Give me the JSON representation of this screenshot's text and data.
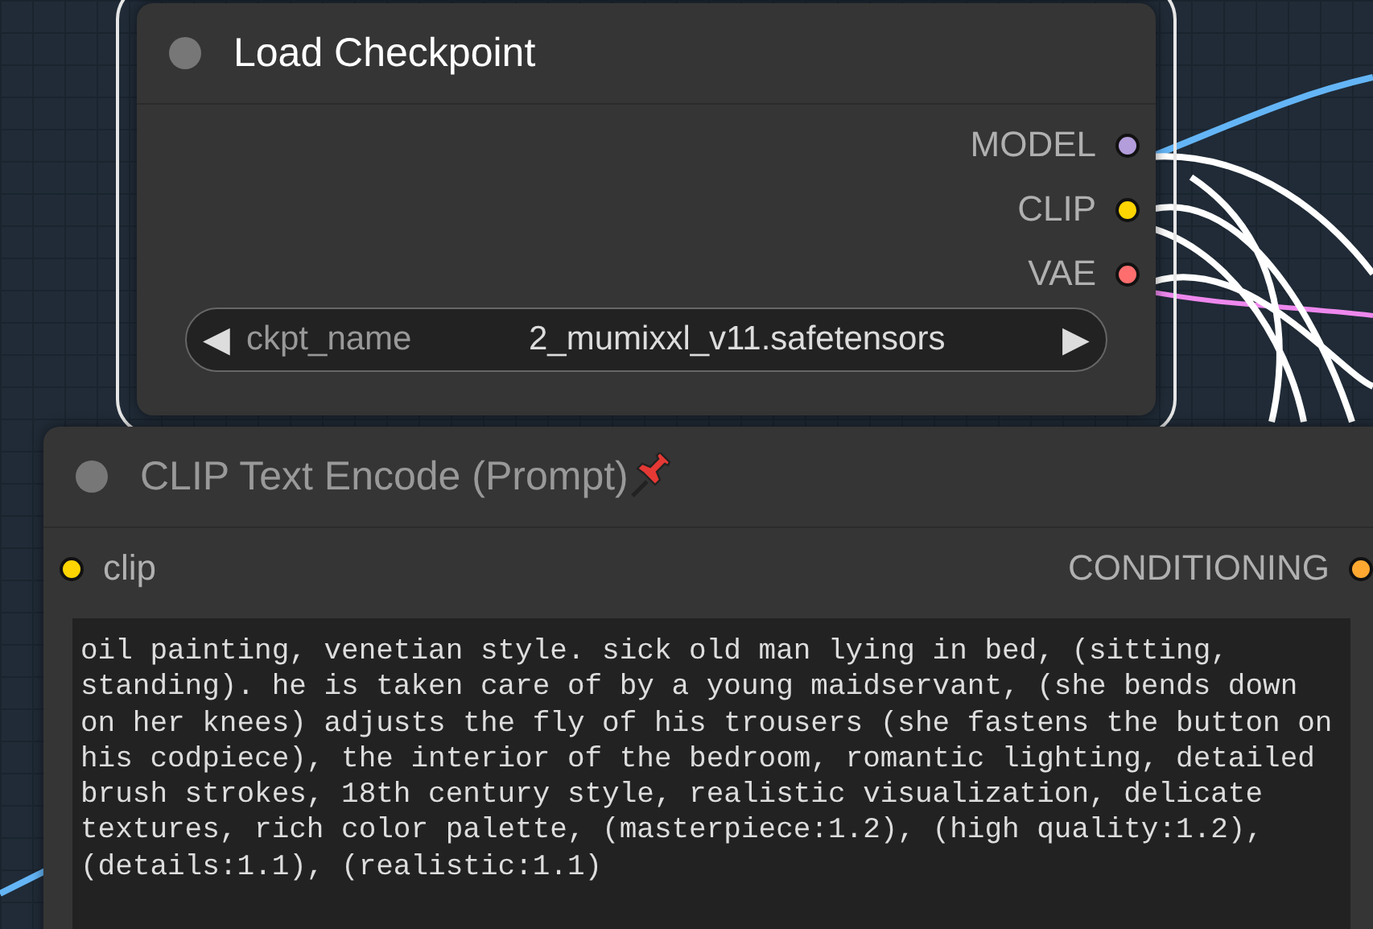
{
  "nodes": [
    {
      "title": "Load Checkpoint",
      "selected": true,
      "pinned": false,
      "outputs": [
        {
          "name": "MODEL",
          "color": "#b39ddb"
        },
        {
          "name": "CLIP",
          "color": "#ffd500"
        },
        {
          "name": "VAE",
          "color": "#ff6e6e"
        }
      ],
      "widgets": [
        {
          "kind": "combo",
          "name": "ckpt_name",
          "value": "2_mumixxl_v11.safetensors",
          "prev": "◀",
          "next": "▶"
        }
      ]
    },
    {
      "title": "CLIP Text Encode (Prompt)",
      "selected": false,
      "pinned": true,
      "inputs": [
        {
          "name": "clip",
          "color": "#ffd500"
        }
      ],
      "outputs": [
        {
          "name": "CONDITIONING",
          "color": "#ffa931"
        }
      ],
      "widgets": [
        {
          "kind": "text",
          "value": "oil painting, venetian style. sick old man lying in bed, (sitting, standing). he is taken care of by a young maidservant, (she bends down on her knees) adjusts the fly of his trousers (she fastens the button on his codpiece), the interior of the bedroom, romantic lighting, detailed brush strokes, 18th century style, realistic visualization, delicate textures, rich color palette, (masterpiece:1.2), (high quality:1.2), (details:1.1), (realistic:1.1)"
        }
      ]
    }
  ]
}
